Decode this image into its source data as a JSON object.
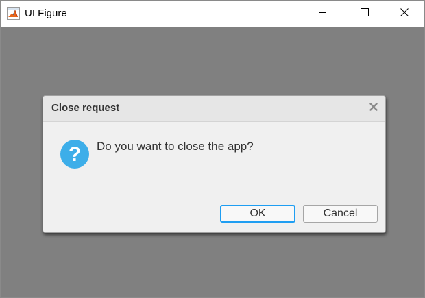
{
  "window": {
    "title": "UI Figure",
    "icons": {
      "app": "matlab-icon",
      "minimize": "minimize-icon",
      "maximize": "maximize-icon",
      "close": "close-icon"
    }
  },
  "dialog": {
    "title": "Close request",
    "message": "Do you want to close the app?",
    "icon": "question-icon",
    "close_icon": "close-icon",
    "ok_label": "OK",
    "cancel_label": "Cancel"
  },
  "colors": {
    "backdrop": "#808080",
    "dialog_bg": "#f0f0f0",
    "dialog_header_bg": "#e6e6e6",
    "accent": "#1f9ef2",
    "question_icon": "#3daee9"
  }
}
